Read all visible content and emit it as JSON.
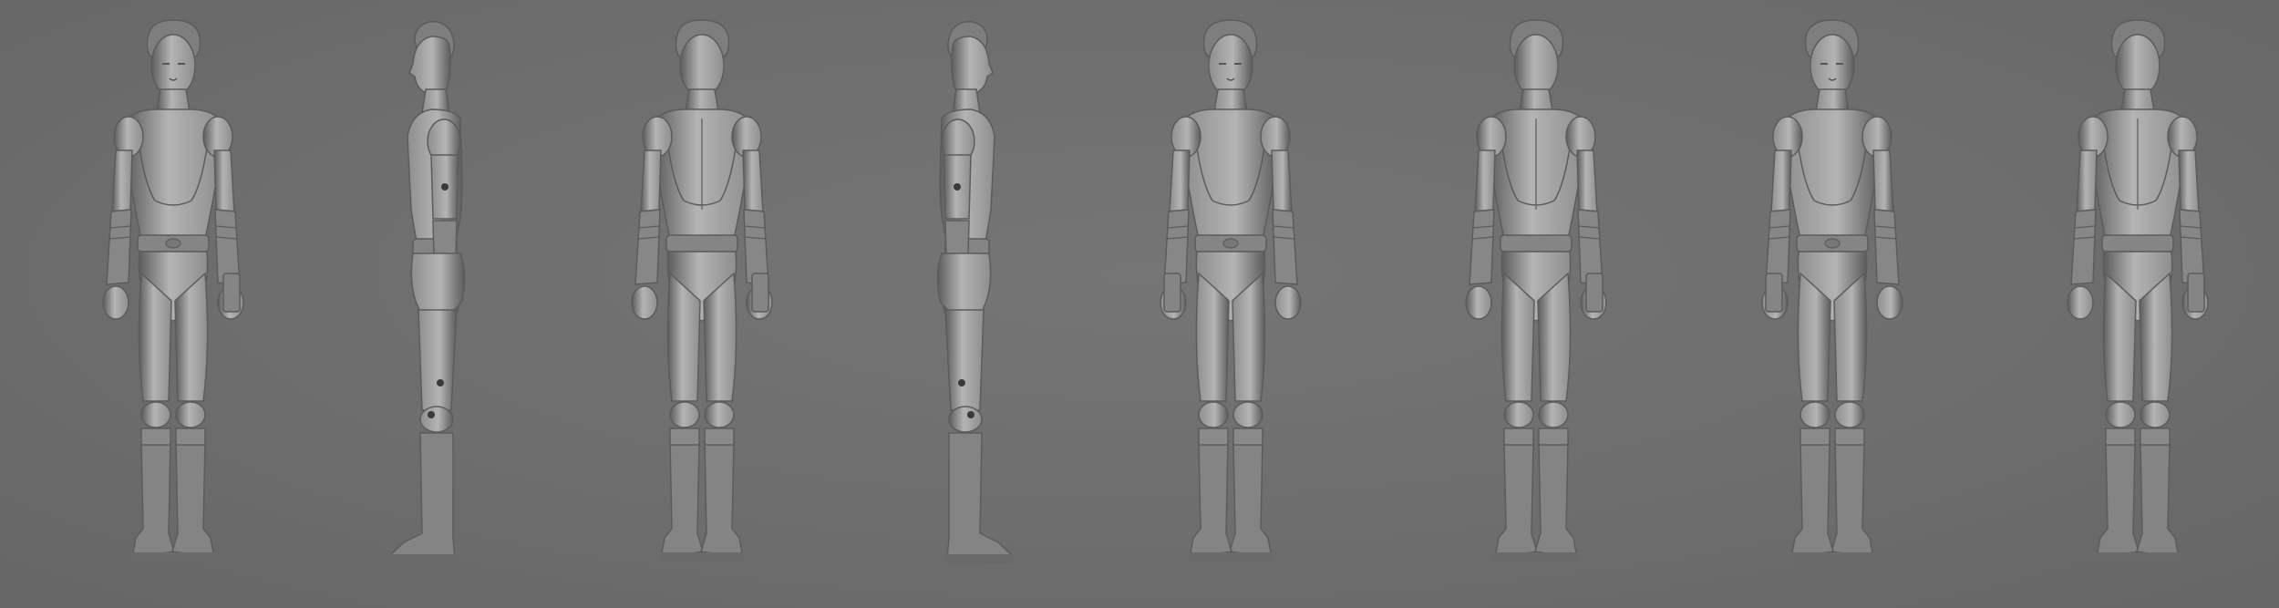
{
  "scene": {
    "background_color": "#6f6f6f",
    "model_color": "#8e8e8e",
    "model_shadow": "#5c5c5c",
    "model_highlight": "#b4b4b4",
    "views": [
      {
        "id": "front",
        "facing": "front"
      },
      {
        "id": "side-right",
        "facing": "side-right"
      },
      {
        "id": "back",
        "facing": "back"
      },
      {
        "id": "side-left",
        "facing": "side-left"
      },
      {
        "id": "three-quarter-front-left",
        "facing": "three-quarter-front"
      },
      {
        "id": "three-quarter-back-left",
        "facing": "three-quarter-back"
      },
      {
        "id": "three-quarter-front-right",
        "facing": "three-quarter-front"
      },
      {
        "id": "three-quarter-back-right",
        "facing": "three-quarter-back"
      }
    ]
  }
}
